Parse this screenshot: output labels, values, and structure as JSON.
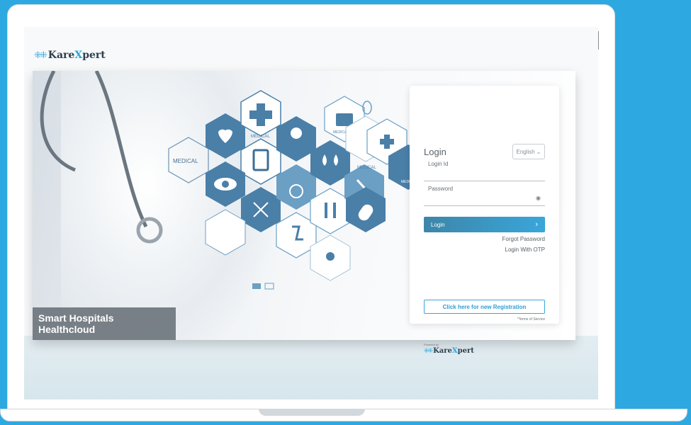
{
  "brand": {
    "name_pre": "Kare",
    "name_x": "X",
    "name_post": "pert",
    "mark": "⁜⁜"
  },
  "hero": {
    "tagline": "Smart Hospitals Healthcloud",
    "hex_labels": {
      "medical_1": "MEDICAL",
      "medical_2": "MEDICAL",
      "medical_3": "MEDICAL",
      "medical_4": "MEDICAL",
      "medical_5": "MEDICAL"
    }
  },
  "login": {
    "title": "Login",
    "language": "English",
    "login_id_label": "Login Id",
    "password_label": "Password",
    "submit_label": "Login",
    "forgot_password": "Forgot Password",
    "login_otp": "Login With OTP",
    "register_label": "Click here for new Registration",
    "terms": "*Terms of Service"
  },
  "footer": {
    "powered_by": "Powered by"
  },
  "colors": {
    "background": "#2ea8e0",
    "accent": "#39a6da",
    "hex_blue": "#4a7fa8"
  }
}
